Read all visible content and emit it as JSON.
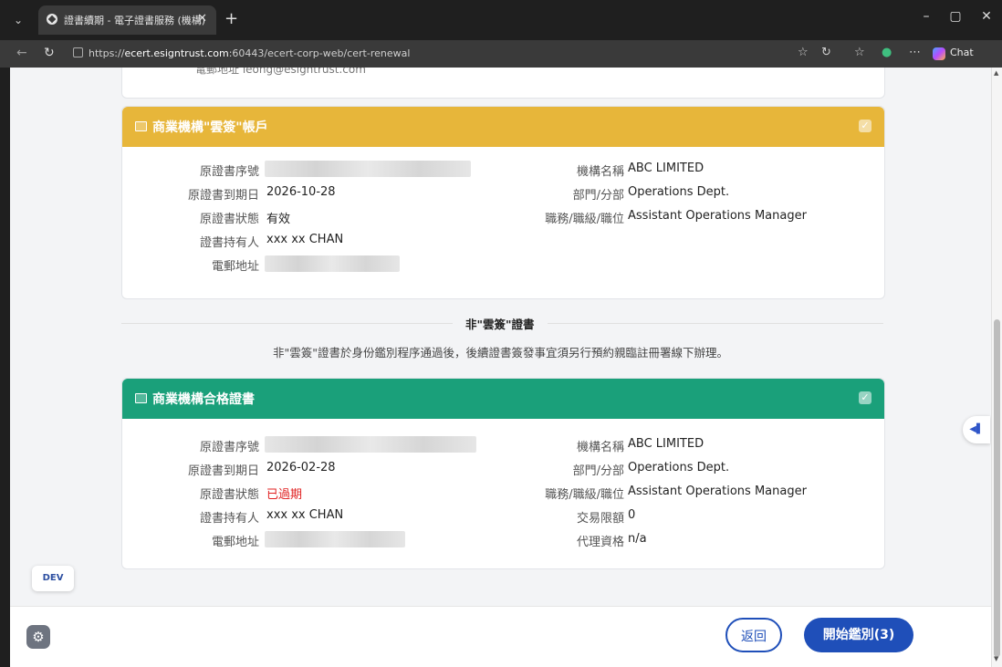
{
  "browser": {
    "tab_title": "證書續期 - 電子證書服務 (機構)",
    "url_prefix": "https://",
    "url_host": "ecert.esigntrust.com",
    "url_path": ":60443/ecert-corp-web/cert-renewal",
    "chat_label": "Chat"
  },
  "top_card": {
    "partial_text": "電郵地址 leong@esigntrust.com"
  },
  "card1": {
    "header": "商業機構\"雲簽\"帳戶",
    "header_color": "#e7b63a",
    "left_fields": [
      {
        "label": "原證書序號",
        "value": ""
      },
      {
        "label": "原證書到期日",
        "value": "2026-10-28"
      },
      {
        "label": "原證書狀態",
        "value": "有效"
      },
      {
        "label": "證書持有人",
        "value": "xxx xx CHAN"
      },
      {
        "label": "電郵地址",
        "value": ""
      }
    ],
    "right_fields": [
      {
        "label": "機構名稱",
        "value": "ABC LIMITED"
      },
      {
        "label": "部門/分部",
        "value": "Operations Dept."
      },
      {
        "label": "職務/職級/職位",
        "value": "Assistant Operations Manager"
      }
    ]
  },
  "divider": {
    "label": "非\"雲簽\"證書",
    "note": "非\"雲簽\"證書於身份鑑別程序通過後，後續證書簽發事宜須另行預約親臨註冊署線下辦理。"
  },
  "card2": {
    "header": "商業機構合格證書",
    "header_color": "#1aa07a",
    "left_fields": [
      {
        "label": "原證書序號",
        "value": ""
      },
      {
        "label": "原證書到期日",
        "value": "2026-02-28"
      },
      {
        "label": "原證書狀態",
        "value": "已過期"
      },
      {
        "label": "證書持有人",
        "value": "xxx xx CHAN"
      },
      {
        "label": "電郵地址",
        "value": ""
      }
    ],
    "right_fields": [
      {
        "label": "機構名稱",
        "value": "ABC LIMITED"
      },
      {
        "label": "部門/分部",
        "value": "Operations Dept."
      },
      {
        "label": "職務/職級/職位",
        "value": "Assistant Operations Manager"
      },
      {
        "label": "交易限額",
        "value": "0"
      },
      {
        "label": "代理資格",
        "value": "n/a"
      }
    ]
  },
  "dev_label": "DEV",
  "footer": {
    "back_label": "返回",
    "start_label": "開始鑑別(3)"
  }
}
